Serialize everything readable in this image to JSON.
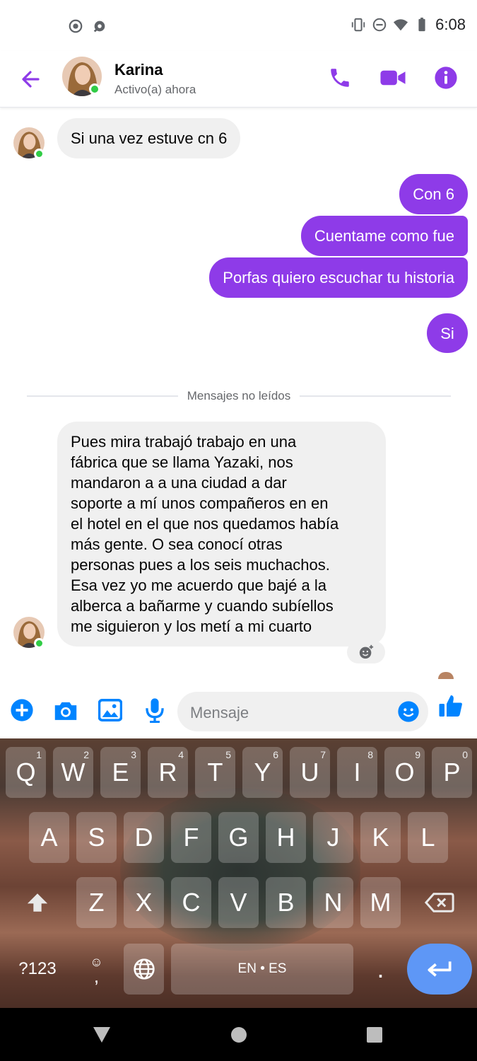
{
  "status_bar": {
    "time": "6:08",
    "left_icons": [
      "screen-record-icon",
      "notification-icon"
    ],
    "right_icons": [
      "vibrate-icon",
      "do-not-disturb-icon",
      "wifi-icon",
      "battery-icon"
    ]
  },
  "header": {
    "contact_name": "Karina",
    "contact_status": "Activo(a) ahora",
    "icons": [
      "back-arrow-icon",
      "phone-icon",
      "video-camera-icon",
      "info-icon"
    ]
  },
  "messages": [
    {
      "direction": "incoming",
      "text": "Si una vez  estuve cn 6"
    },
    {
      "direction": "outgoing",
      "text": "Con 6"
    },
    {
      "direction": "outgoing",
      "text": "Cuentame como fue"
    },
    {
      "direction": "outgoing",
      "text": "Porfas quiero escuchar tu historia"
    },
    {
      "direction": "outgoing",
      "text": "Si"
    },
    {
      "direction": "incoming",
      "lines": [
        "Pues mira trabajó trabajo en una",
        "fábrica que se llama Yazaki, nos",
        "mandaron a a una ciudad a dar",
        "soporte a mí unos compañeros en en",
        "el hotel en el que nos quedamos había",
        "más gente. O sea conocí otras",
        "personas pues a los seis muchachos.",
        "Esa vez yo me acuerdo que bajé a la",
        "alberca a bañarme y cuando subíellos",
        "me siguieron y los metí a mi cuarto"
      ]
    }
  ],
  "unread_divider": "Mensajes no leídos",
  "composer": {
    "placeholder": "Mensaje",
    "icons": [
      "plus-icon",
      "camera-icon",
      "gallery-icon",
      "microphone-icon",
      "emoji-icon",
      "thumbs-up-icon"
    ]
  },
  "keyboard": {
    "row1": [
      [
        "Q",
        "1"
      ],
      [
        "W",
        "2"
      ],
      [
        "E",
        "3"
      ],
      [
        "R",
        "4"
      ],
      [
        "T",
        "5"
      ],
      [
        "Y",
        "6"
      ],
      [
        "U",
        "7"
      ],
      [
        "I",
        "8"
      ],
      [
        "O",
        "9"
      ],
      [
        "P",
        "0"
      ]
    ],
    "row2": [
      "A",
      "S",
      "D",
      "F",
      "G",
      "H",
      "J",
      "K",
      "L"
    ],
    "row3": [
      "Z",
      "X",
      "C",
      "V",
      "B",
      "N",
      "M"
    ],
    "symbols_label": "?123",
    "emoji_comma_top": "☺",
    "emoji_comma_bottom": ",",
    "space_label": "EN • ES",
    "period_label": "."
  },
  "colors": {
    "accent": "#8e3be8",
    "incoming_bubble": "#f0f0f0",
    "online": "#31cc46",
    "composer_blue": "#0084ff",
    "enter_key": "#5e97f6"
  }
}
